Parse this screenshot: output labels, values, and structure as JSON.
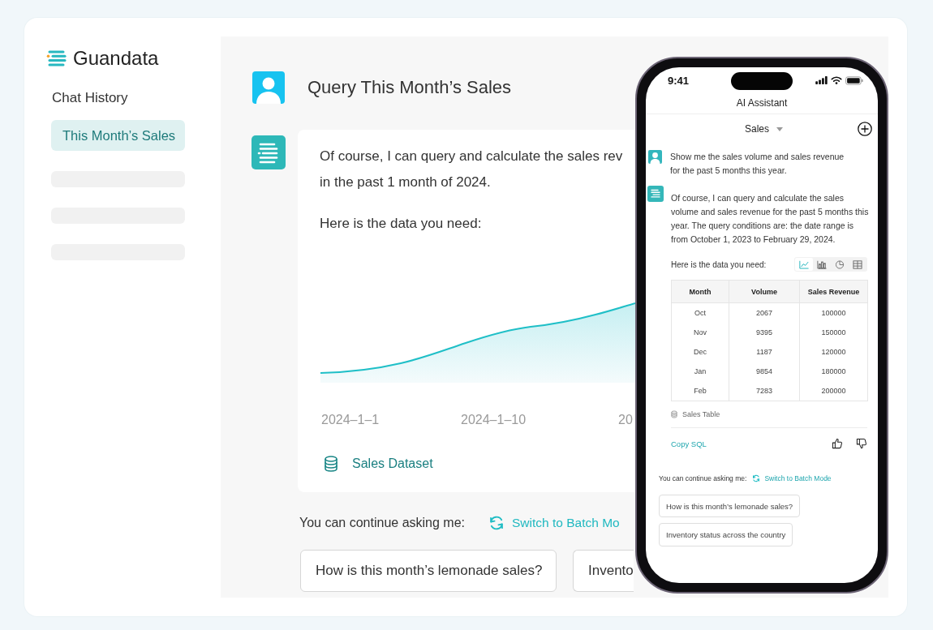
{
  "sidebar": {
    "logo": "Guandata",
    "section_title": "Chat History",
    "items": [
      {
        "kind": "entry",
        "label": "This Month’s Sales",
        "selected": true
      },
      {
        "kind": "skeleton",
        "selected": false
      },
      {
        "kind": "skeleton",
        "selected": false
      },
      {
        "kind": "skeleton",
        "selected": false
      }
    ]
  },
  "conversation": {
    "question": "Query This Month’s Sales",
    "answer": {
      "lines": [
        "Of course, I can query and calculate the sales rev",
        "in the past 1 month of 2024."
      ],
      "lead_in": "Here is the data you need:",
      "chart": {
        "x_labels": [
          "2024–1–1",
          "2024–1–10",
          "20"
        ]
      },
      "source": "Sales Dataset"
    },
    "follow_up": {
      "prompt": "You can continue asking me:",
      "switch_link": "Switch to Batch Mo",
      "suggestions": [
        "How is this month’s lemonade sales?",
        "Invento"
      ]
    }
  },
  "phone": {
    "status_bar": {
      "time": "9:41"
    },
    "title": "AI Assistant",
    "topic": "Sales",
    "messages": [
      {
        "kind": "user",
        "text": "Show me the sales volume and sales revenue for the past 5 months this year."
      },
      {
        "kind": "assistant",
        "text": "Of course, I can query and calculate the sales volume and sales revenue for the past 5 months this year. The query conditions are: the date range is from October 1, 2023 to February 29, 2024."
      }
    ],
    "lead_in": "Here is the data you need:",
    "view_toggle": [
      {
        "kind": "line",
        "selected": true
      },
      {
        "kind": "bar",
        "selected": false
      },
      {
        "kind": "pie",
        "selected": false
      },
      {
        "kind": "table",
        "selected": false
      }
    ],
    "table": {
      "columns": [
        "Month",
        "Volume",
        "Sales Revenue"
      ],
      "rows": [
        [
          "Oct",
          "2067",
          "100000"
        ],
        [
          "Nov",
          "9395",
          "150000"
        ],
        [
          "Dec",
          "1187",
          "120000"
        ],
        [
          "Jan",
          "9854",
          "180000"
        ],
        [
          "Feb",
          "7283",
          "200000"
        ]
      ]
    },
    "source": "Sales Table",
    "copy_link": "Copy SQL",
    "follow_up": {
      "prompt": "You can continue asking me:",
      "switch_link": "Switch to Batch Mode",
      "suggestions": [
        "How is this month’s lemonade sales?",
        "Inventory status across the country"
      ]
    }
  }
}
